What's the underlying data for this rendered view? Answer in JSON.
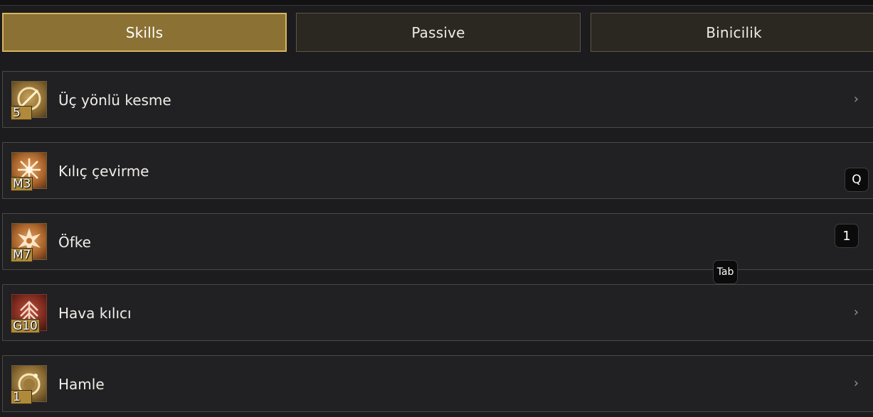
{
  "tabs": [
    {
      "label": "Skills",
      "active": true
    },
    {
      "label": "Passive",
      "active": false
    },
    {
      "label": "Binicilik",
      "active": false
    }
  ],
  "skills": [
    {
      "name": "Üç yönlü kesme",
      "level": "5",
      "icon": "sword-circle-icon",
      "color": "gold"
    },
    {
      "name": "Kılıç çevirme",
      "level": "M3",
      "icon": "spinning-blades-icon",
      "color": "orange"
    },
    {
      "name": "Öfke",
      "level": "M7",
      "icon": "rage-burst-icon",
      "color": "orange"
    },
    {
      "name": "Hava kılıcı",
      "level": "G10",
      "icon": "air-sword-icon",
      "color": "red"
    },
    {
      "name": "Hamle",
      "level": "1",
      "icon": "dash-ring-icon",
      "color": "gold"
    }
  ],
  "chevron": "›",
  "key_hints": {
    "q": "Q",
    "one": "1",
    "tab": "Tab"
  },
  "colors": {
    "active_tab": "#8b7133",
    "active_border": "#d6b55e",
    "row_bg": "#212124"
  }
}
